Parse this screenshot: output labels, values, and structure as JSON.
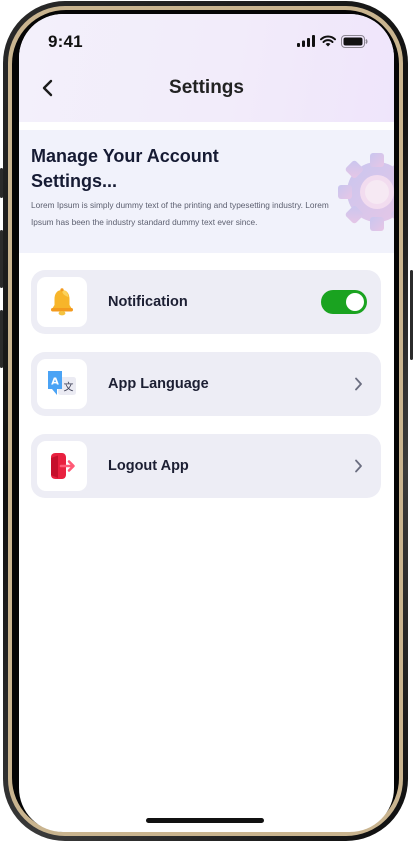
{
  "status_bar": {
    "time": "9:41"
  },
  "header": {
    "title": "Settings"
  },
  "hero": {
    "title": "Manage Your Account Settings...",
    "description": "Lorem Ipsum is simply dummy text of the printing and typesetting industry. Lorem Ipsum has been the industry standard dummy text ever since."
  },
  "settings": [
    {
      "label": "Notification",
      "icon": "bell-icon",
      "control": "toggle",
      "enabled": true
    },
    {
      "label": "App Language",
      "icon": "translate-icon",
      "control": "chevron"
    },
    {
      "label": "Logout App",
      "icon": "logout-icon",
      "control": "chevron"
    }
  ],
  "colors": {
    "toggle_on": "#1aa320",
    "card_bg": "#ededf5",
    "hero_bg": "#f1f2fb",
    "text_dark": "#1c1f33",
    "logout_red": "#e8213f",
    "language_blue": "#4aa3f5",
    "bell_orange": "#f5a623"
  }
}
